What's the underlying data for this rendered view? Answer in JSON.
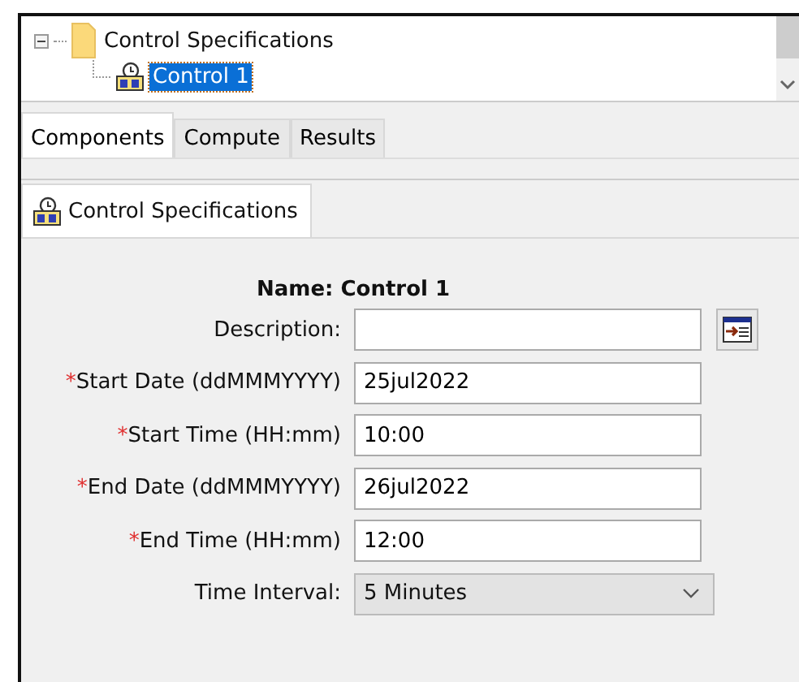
{
  "tree": [
    {
      "label": "Control Specifications",
      "expanded": true,
      "selected": false,
      "children": [
        {
          "label": "Control 1",
          "selected": true
        }
      ]
    }
  ],
  "tabs": [
    {
      "label": "Components",
      "selected": true
    },
    {
      "label": "Compute",
      "selected": false
    },
    {
      "label": "Results",
      "selected": false
    }
  ],
  "panel_tab": {
    "label": "Control Specifications"
  },
  "form": {
    "name": "Name: Control 1",
    "fields": [
      {
        "kind": "text",
        "label": "Description:",
        "button": true
      },
      {
        "kind": "text",
        "marker": "*",
        "label": "Start Date (ddMMMYYYY)",
        "value": "25jul2022"
      },
      {
        "kind": "text",
        "marker": "*",
        "label": "Start Time (HH:mm)",
        "value": "10:00"
      },
      {
        "kind": "text",
        "marker": "*",
        "label": "End Date (ddMMMYYYY)",
        "value": "26jul2022"
      },
      {
        "kind": "text",
        "marker": "*",
        "label": "End Time (HH:mm)",
        "value": "12:00"
      },
      {
        "kind": "select",
        "label": "Time Interval:",
        "value": "5 Minutes"
      }
    ]
  }
}
